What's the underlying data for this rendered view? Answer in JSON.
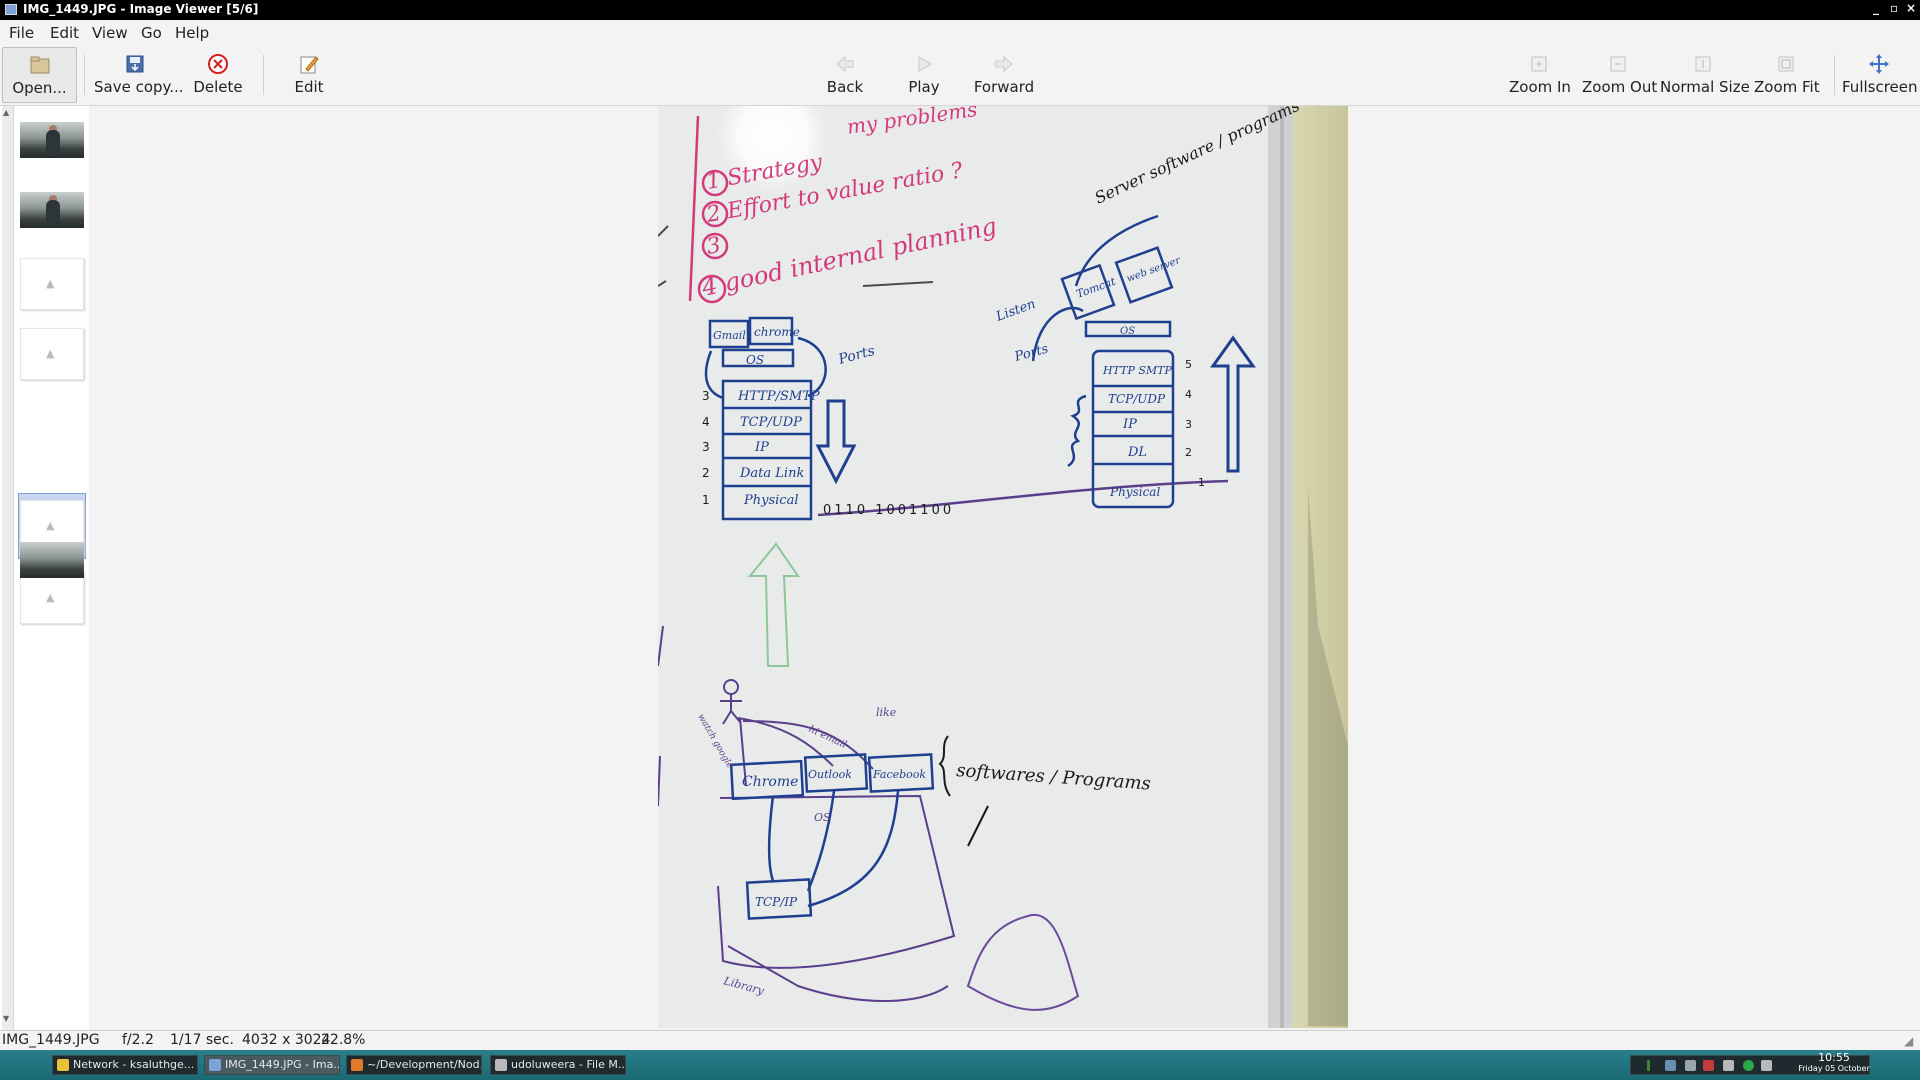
{
  "window": {
    "title": "IMG_1449.JPG - Image Viewer [5/6]",
    "controls": [
      "_",
      "▫",
      "×"
    ]
  },
  "menu": {
    "items": [
      "File",
      "Edit",
      "View",
      "Go",
      "Help"
    ]
  },
  "toolbar": {
    "open": "Open...",
    "save_copy": "Save copy...",
    "delete": "Delete",
    "edit": "Edit",
    "back": "Back",
    "play": "Play",
    "forward": "Forward",
    "zoom_in": "Zoom In",
    "zoom_out": "Zoom Out",
    "normal_size": "Normal Size",
    "zoom_fit": "Zoom Fit",
    "fullscreen": "Fullscreen"
  },
  "whiteboard": {
    "list": [
      "my problems",
      "1 Strategy",
      "2 Effort to value ratio ?",
      "3",
      "4 good internal planning"
    ],
    "server_label": "Server software / programs",
    "server_apps": [
      "Tomcat",
      "web server"
    ],
    "client_apps": [
      "Gmail",
      "chrome"
    ],
    "os": "OS",
    "listen": "Listen",
    "ports": "Ports",
    "client_stack": [
      "HTTP/SMTP",
      "TCP/UDP",
      "IP",
      "Data Link",
      "Physical"
    ],
    "client_numbers": [
      "3",
      "4",
      "3",
      "2",
      "1"
    ],
    "server_stack": [
      "HTTP SMTP",
      "TCP/UDP",
      "IP",
      "DL",
      "Physical"
    ],
    "server_numbers": [
      "5",
      "4",
      "3",
      "2",
      "1"
    ],
    "bits": "0110     1001100",
    "bottom_apps": [
      "Chrome",
      "Outlook",
      "Facebook"
    ],
    "bottom_label": "softwares / Programs",
    "bottom_arrows": [
      "hi email",
      "like"
    ],
    "bottom_side": "watch google",
    "bottom_os": "OS",
    "tcpip": "TCP/IP",
    "library": "Library"
  },
  "status": {
    "filename": "IMG_1449.JPG",
    "aperture": "f/2.2",
    "exposure": "1/17 sec.",
    "dimensions": "4032 x 3024",
    "zoom": "22.8%"
  },
  "taskbar": {
    "tasks": [
      "Network - ksaluthge...",
      "IMG_1449.JPG - Ima...",
      "~/Development/Nod...",
      "udoluweera - File M..."
    ],
    "time": "10:55",
    "date": "Friday 05 October"
  },
  "colors": {
    "titlebar": "#000000",
    "taskbar": "#196a74",
    "marker_blue": "#1f3f8f",
    "marker_pink": "#d43a7a",
    "marker_purple": "#5b3f8c",
    "marker_black": "#1a1a1a"
  }
}
